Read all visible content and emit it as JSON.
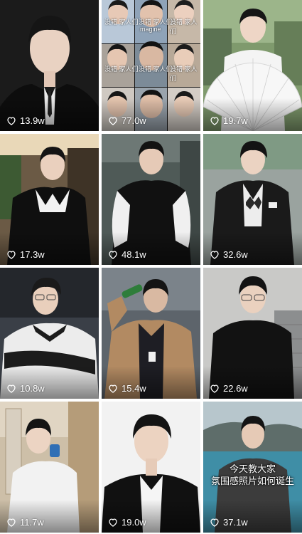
{
  "feed": {
    "items": [
      {
        "likes": "13.9w"
      },
      {
        "likes": "77.0w"
      },
      {
        "likes": "19.7w"
      },
      {
        "likes": "17.3w"
      },
      {
        "likes": "48.1w"
      },
      {
        "likes": "32.6w"
      },
      {
        "likes": "10.8w"
      },
      {
        "likes": "15.4w"
      },
      {
        "likes": "22.6w"
      },
      {
        "likes": "11.7w"
      },
      {
        "likes": "19.0w"
      },
      {
        "likes": "37.1w",
        "caption_line1": "今天教大家",
        "caption_line2": "氛围感照片如何诞生"
      }
    ],
    "mosaic_caption": "没错 家人们",
    "mosaic_logo": "magine"
  },
  "colors": {
    "like_text": "#ffffff",
    "background": "#ffffff"
  },
  "icons": {
    "like": "heart-icon"
  }
}
